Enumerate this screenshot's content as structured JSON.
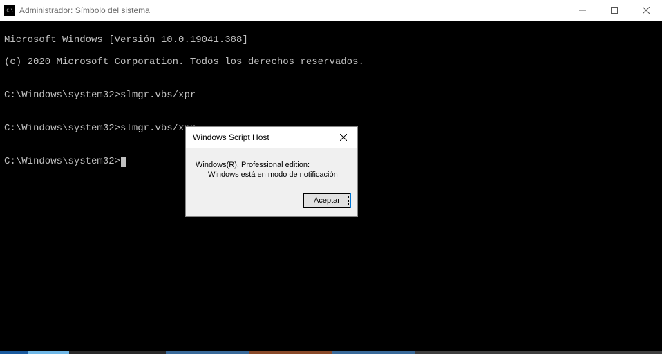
{
  "window": {
    "title": "Administrador: Símbolo del sistema"
  },
  "terminal": {
    "line1": "Microsoft Windows [Versión 10.0.19041.388]",
    "line2": "(c) 2020 Microsoft Corporation. Todos los derechos reservados.",
    "prompt1": "C:\\Windows\\system32>",
    "cmd1": "slmgr.vbs/xpr",
    "prompt2": "C:\\Windows\\system32>",
    "cmd2": "slmgr.vbs/xpr",
    "prompt3": "C:\\Windows\\system32>"
  },
  "dialog": {
    "title": "Windows Script Host",
    "line1": "Windows(R), Professional edition:",
    "line2": "Windows está en modo de notificación",
    "ok_label": "Aceptar"
  },
  "taskbar_colors": [
    "#0078d7",
    "#5fb0e8",
    "#2a2a2a",
    "#d06a2f",
    "#0078d7",
    "#505050"
  ]
}
